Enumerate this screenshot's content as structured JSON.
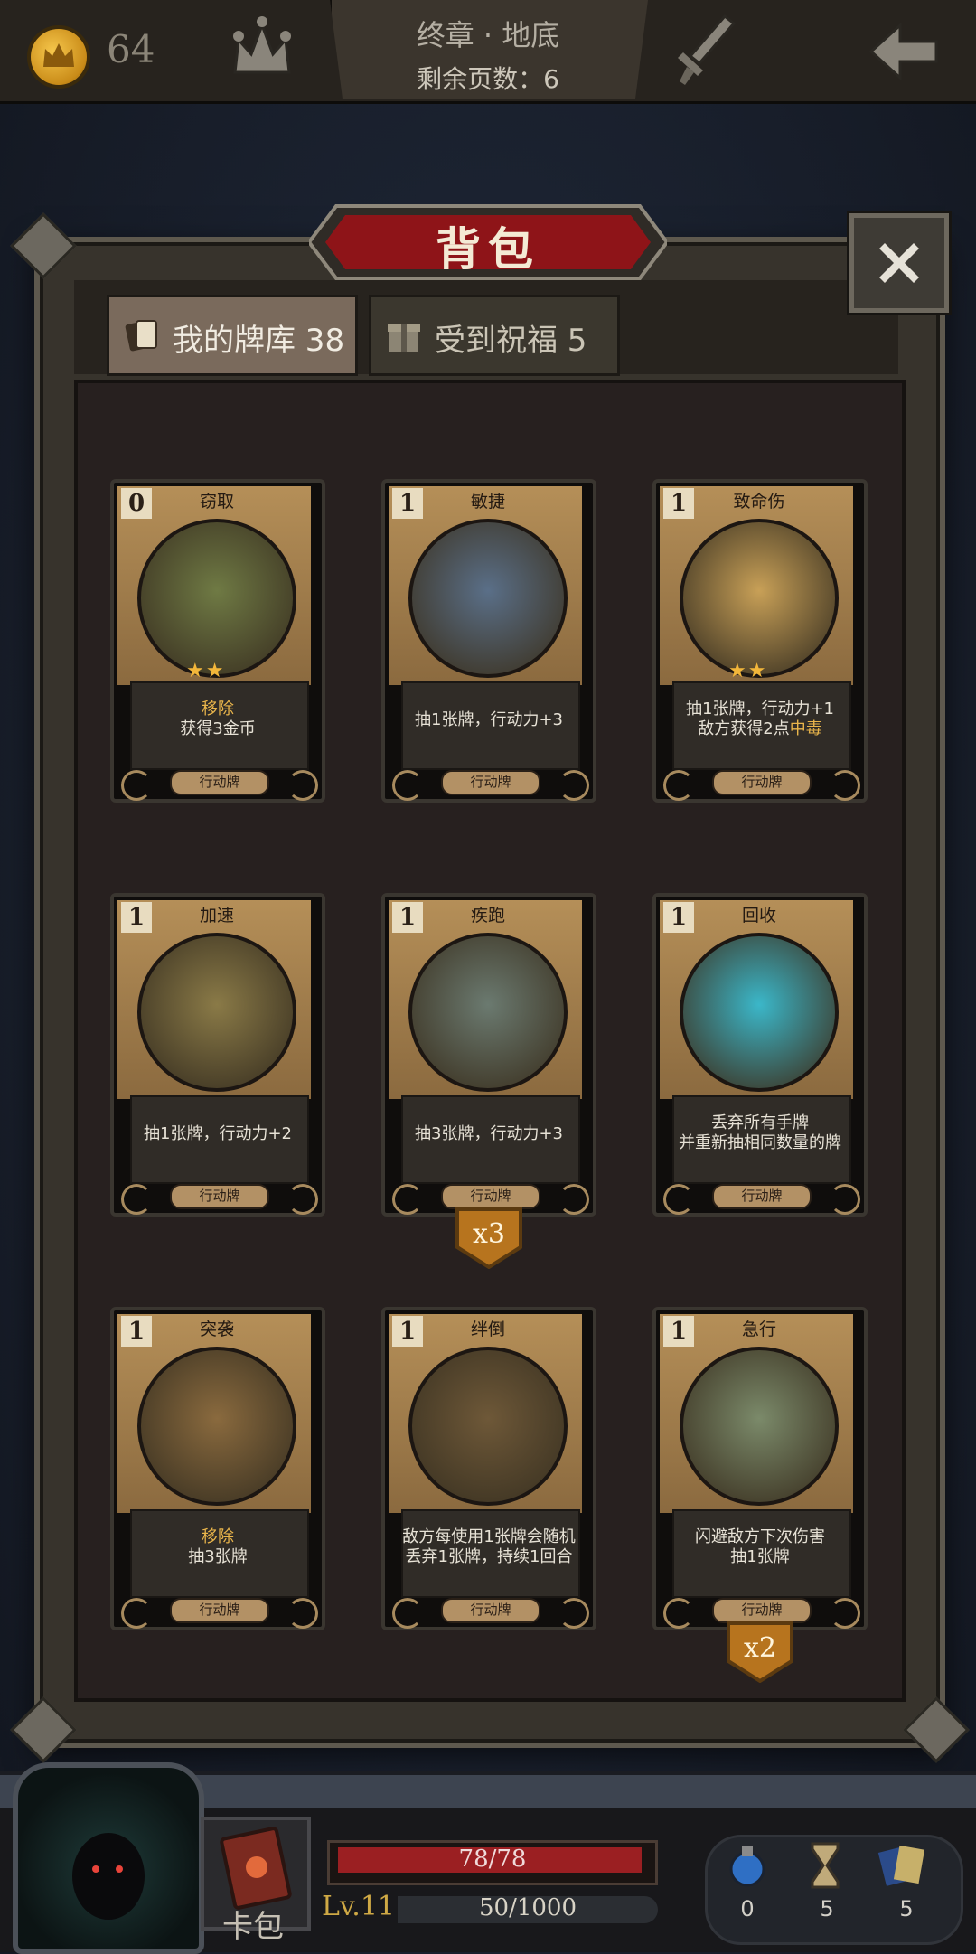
{
  "topbar": {
    "coins": "64",
    "chapter_title": "终章 · 地底",
    "pages_remaining": "剩余页数：6"
  },
  "modal": {
    "title": "背包",
    "tabs": [
      {
        "label": "我的牌库 38",
        "active": true,
        "icon": "cards-icon"
      },
      {
        "label": "受到祝福 5",
        "active": false,
        "icon": "gift-icon"
      }
    ]
  },
  "cards": [
    {
      "cost": "0",
      "name": "窃取",
      "desc_remove": "移除",
      "desc": "获得3金币",
      "type": "行动牌",
      "stars": "★★",
      "art_color": "#6f7a44"
    },
    {
      "cost": "1",
      "name": "敏捷",
      "desc_remove": "",
      "desc": "抽1张牌，行动力+3",
      "type": "行动牌",
      "stars": "",
      "art_color": "#5a6f88"
    },
    {
      "cost": "1",
      "name": "致命伤",
      "desc_remove": "",
      "desc": "抽1张牌，行动力+1",
      "desc2": "敌方获得2点",
      "desc2_highlight": "中毒",
      "type": "行动牌",
      "stars": "★★",
      "art_color": "#c8a057"
    },
    {
      "cost": "1",
      "name": "加速",
      "desc_remove": "",
      "desc": "抽1张牌，行动力+2",
      "type": "行动牌",
      "stars": "",
      "art_color": "#8a7a47"
    },
    {
      "cost": "1",
      "name": "疾跑",
      "desc_remove": "",
      "desc": "抽3张牌，行动力+3",
      "type": "行动牌",
      "stars": "",
      "art_color": "#6b7a70",
      "multiplier": "x3"
    },
    {
      "cost": "1",
      "name": "回收",
      "desc_remove": "",
      "desc": "丢弃所有手牌",
      "desc2": "并重新抽相同数量的牌",
      "type": "行动牌",
      "stars": "",
      "art_color": "#3bb7c9"
    },
    {
      "cost": "1",
      "name": "突袭",
      "desc_remove": "移除",
      "desc": "抽3张牌",
      "type": "行动牌",
      "stars": "",
      "art_color": "#8a6a3e"
    },
    {
      "cost": "1",
      "name": "绊倒",
      "desc_remove": "",
      "desc": "敌方每使用1张牌会随机",
      "desc2": "丢弃1张牌，持续1回合",
      "type": "行动牌",
      "stars": "",
      "art_color": "#6e5838"
    },
    {
      "cost": "1",
      "name": "急行",
      "desc_remove": "",
      "desc": "闪避敌方下次伤害",
      "desc2": "抽1张牌",
      "type": "行动牌",
      "stars": "",
      "art_color": "#7b8a6a",
      "multiplier": "x2"
    }
  ],
  "hud": {
    "cardpack_label": "卡包",
    "hp": "78/78",
    "hp_fraction": 1.0,
    "level": "Lv.11",
    "xp": "50/1000",
    "xp_fraction": 0.05,
    "resources": [
      {
        "icon": "potion-icon",
        "value": "0"
      },
      {
        "icon": "hourglass-icon",
        "value": "5"
      },
      {
        "icon": "card-stack-icon",
        "value": "5"
      }
    ]
  }
}
